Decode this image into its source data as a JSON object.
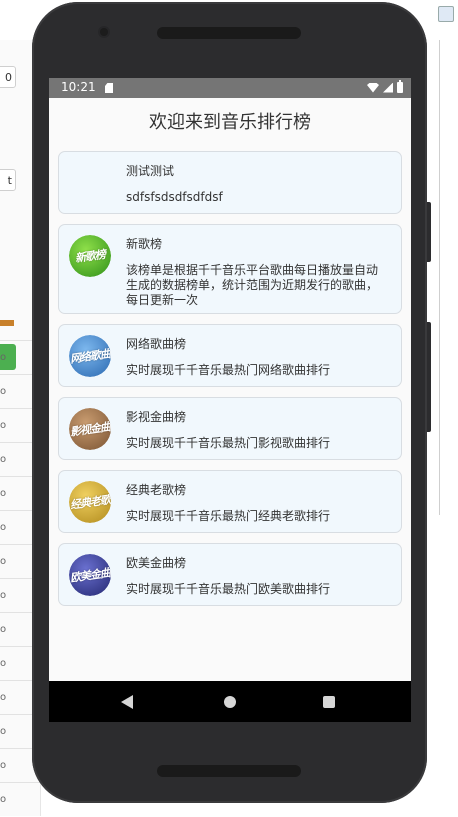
{
  "status_bar": {
    "time": "10:21"
  },
  "page_title": "欢迎来到音乐排行榜",
  "charts": [
    {
      "name": "测试测试",
      "description": "sdfsfsdsdfsdfdsf",
      "icon": "",
      "thumb_text": "",
      "color": "#f1f8fd"
    },
    {
      "name": "新歌榜",
      "description": "该榜单是根据千千音乐平台歌曲每日播放量自动生成的数据榜单，统计范围为近期发行的歌曲，每日更新一次",
      "icon": "new-songs-icon",
      "thumb_text": "新歌榜",
      "color": "#5bb82a"
    },
    {
      "name": "网络歌曲榜",
      "description": "实时展现千千音乐最热门网络歌曲排行",
      "icon": "internet-songs-icon",
      "thumb_text": "网络歌曲",
      "color": "#4a90d6"
    },
    {
      "name": "影视金曲榜",
      "description": "实时展现千千音乐最热门影视歌曲排行",
      "icon": "film-tv-songs-icon",
      "thumb_text": "影视金曲",
      "color": "#a87b52"
    },
    {
      "name": "经典老歌榜",
      "description": "实时展现千千音乐最热门经典老歌排行",
      "icon": "classic-songs-icon",
      "thumb_text": "经典老歌",
      "color": "#d8b13a"
    },
    {
      "name": "欧美金曲榜",
      "description": "实时展现千千音乐最热门欧美歌曲排行",
      "icon": "western-songs-icon",
      "thumb_text": "欧美金曲",
      "color": "#3a3f9a"
    }
  ],
  "background_window": {
    "field_value": "0",
    "button_label": "t",
    "row_label": "o"
  }
}
